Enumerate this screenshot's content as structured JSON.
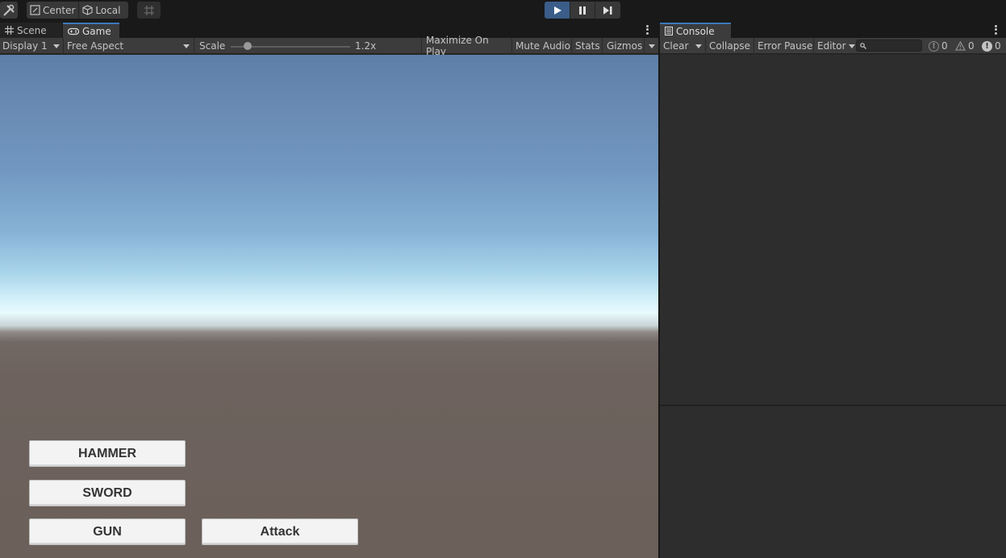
{
  "toolbar": {
    "pivot_center": "Center",
    "pivot_local": "Local",
    "play_icon": "play-icon",
    "pause_icon": "pause-icon",
    "step_icon": "step-icon"
  },
  "game_panel": {
    "tabs": [
      {
        "label": "Scene",
        "icon": "grid-icon"
      },
      {
        "label": "Game",
        "icon": "gamepad-icon"
      }
    ],
    "display": "Display 1",
    "aspect": "Free Aspect",
    "scale_label": "Scale",
    "scale_value": "1.2x",
    "maximize": "Maximize On Play",
    "mute": "Mute Audio",
    "stats": "Stats",
    "gizmos": "Gizmos"
  },
  "game_view": {
    "buttons": {
      "hammer": "HAMMER",
      "sword": "SWORD",
      "gun": "GUN",
      "attack": "Attack"
    }
  },
  "console": {
    "tab": "Console",
    "clear": "Clear",
    "collapse": "Collapse",
    "error_pause": "Error Pause",
    "editor": "Editor",
    "log_count": "0",
    "warning_count": "0",
    "error_count": "0"
  },
  "colors": {
    "play_active": "#3a5d89",
    "tab_accent": "#3a79bb",
    "panel_bg": "#282828"
  }
}
